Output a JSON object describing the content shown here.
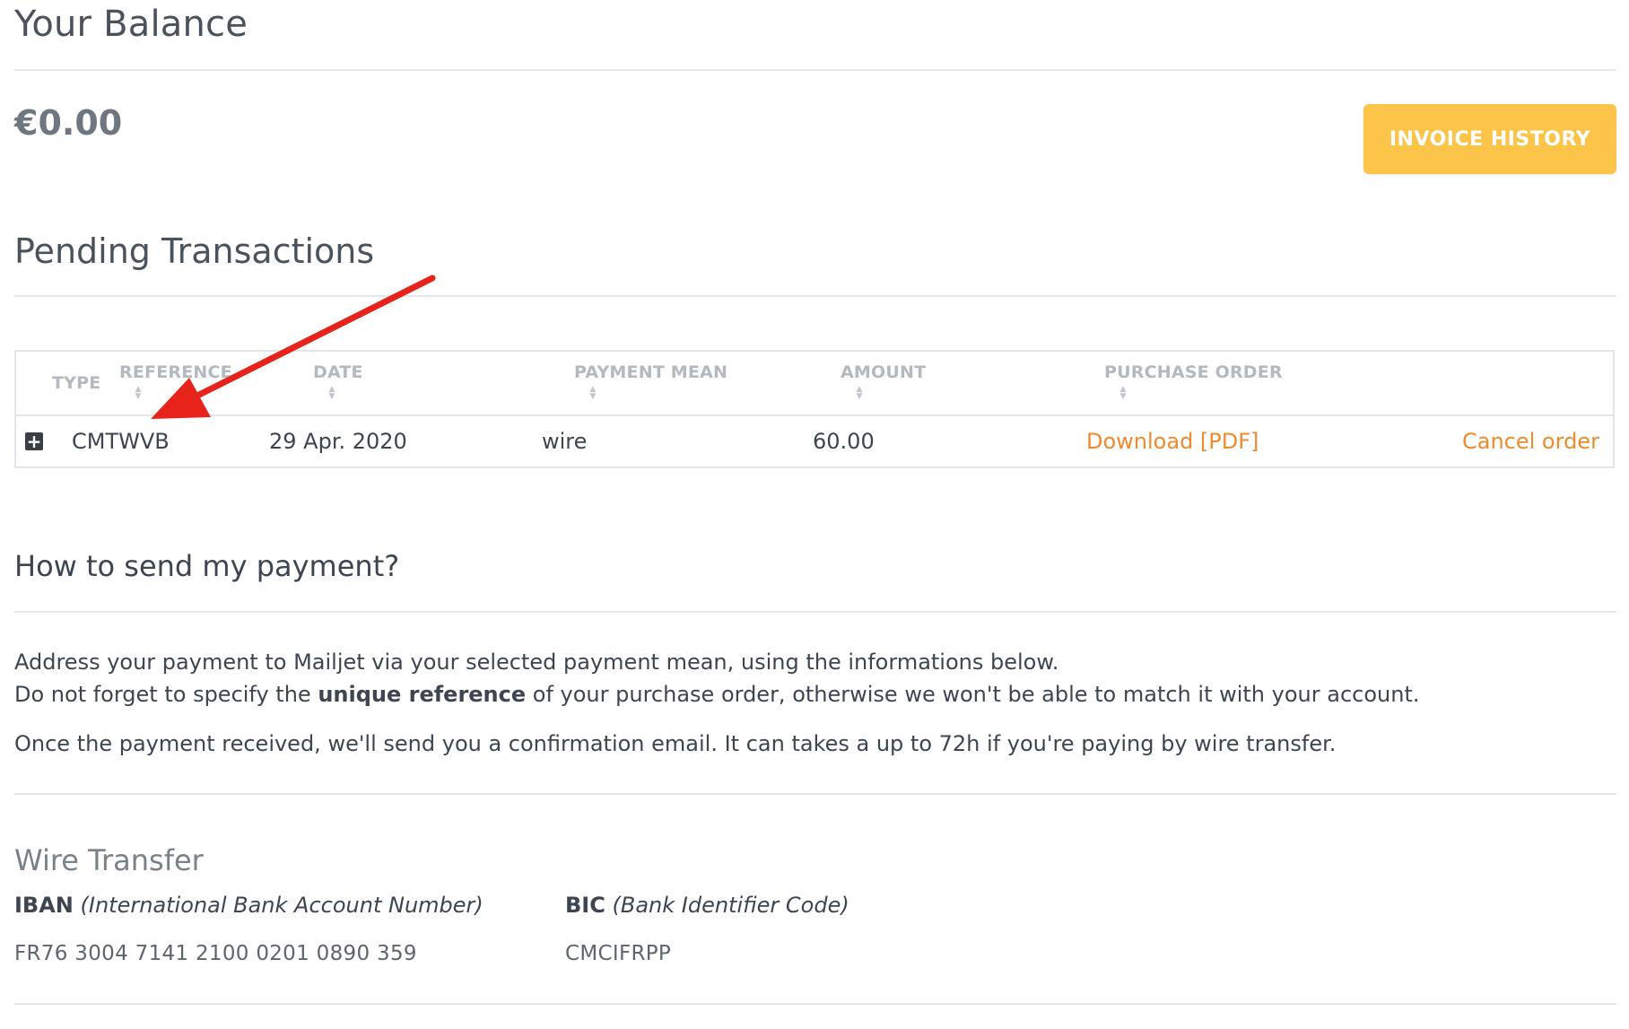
{
  "balance_section": {
    "title": "Your Balance",
    "amount": "€0.00",
    "invoice_history_label": "INVOICE HISTORY"
  },
  "pending": {
    "title": "Pending Transactions",
    "columns": [
      "TYPE",
      "REFERENCE",
      "DATE",
      "PAYMENT MEAN",
      "AMOUNT",
      "PURCHASE ORDER"
    ],
    "rows": [
      {
        "expand_icon": "plus-square-icon",
        "reference": "CMTWVB",
        "date": "29 Apr. 2020",
        "payment_mean": "wire",
        "amount": "60.00",
        "purchase_order": "Download [PDF]",
        "action": "Cancel order"
      }
    ]
  },
  "how_to": {
    "title": "How to send my payment?",
    "line1": "Address your payment to Mailjet via your selected payment mean, using the informations below.",
    "line2_pre": "Do not forget to specify the ",
    "line2_bold": "unique reference",
    "line2_post": " of your purchase order, otherwise we won't be able to match it with your account.",
    "line3": "Once the payment received, we'll send you a confirmation email. It can takes a up to 72h if you're paying by wire transfer."
  },
  "wire": {
    "title": "Wire Transfer",
    "iban_label": "IBAN",
    "iban_desc": "(International Bank Account Number)",
    "iban_value": "FR76 3004 7141 2100 0201 0890 359",
    "bic_label": "BIC",
    "bic_desc": "(Bank Identifier Code)",
    "bic_value": "CMCIFRPP"
  },
  "colors": {
    "accent": "#fcc54a",
    "link": "#ef8b2c",
    "annotation_arrow": "#e8231b"
  }
}
